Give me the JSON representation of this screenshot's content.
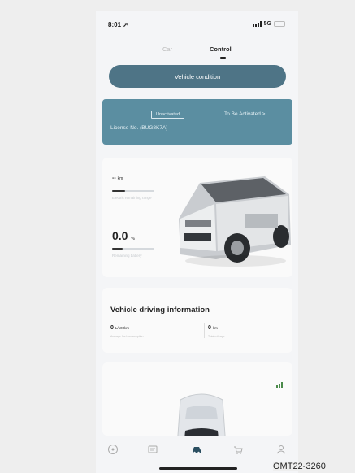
{
  "status_bar": {
    "time": "8:01",
    "network": "5G"
  },
  "tabs": [
    {
      "label": "Car",
      "active": false
    },
    {
      "label": "Control",
      "active": true
    }
  ],
  "vehicle_condition_button": "Vehicle condition",
  "license_card": {
    "tag": "Unactivated",
    "activation_status": "To Be Activated >",
    "license_no": "License No. (BUG8K7A)"
  },
  "range": {
    "value": "--",
    "unit": "km",
    "label": "Electric remaining range",
    "bar_fill": 0.3
  },
  "battery": {
    "value": "0.0",
    "unit": "%",
    "label": "Remaining battery",
    "bar_fill": 0.25
  },
  "driving_info": {
    "title": "Vehicle driving information",
    "power": {
      "value": "0",
      "unit": "L/100km",
      "label": "Average fuel consumption"
    },
    "mileage": {
      "value": "0",
      "unit": "km",
      "label": "Total mileage"
    }
  },
  "colors": {
    "accent": "#4e7486",
    "card": "#5b8ea1",
    "background": "#f4f5f7"
  },
  "tabbar": [
    {
      "icon": "discover-icon"
    },
    {
      "icon": "message-icon"
    },
    {
      "icon": "car-icon",
      "active": true
    },
    {
      "icon": "shop-icon"
    },
    {
      "icon": "profile-icon"
    }
  ],
  "caption": "OMT22-3260"
}
